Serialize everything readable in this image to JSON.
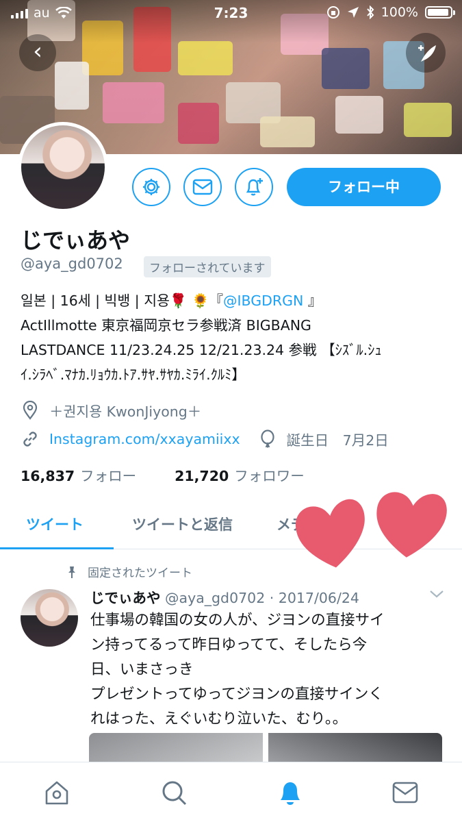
{
  "status_bar": {
    "carrier": "au",
    "time": "7:23",
    "battery": "100%"
  },
  "profile": {
    "name": "じでぃあや",
    "handle": "@aya_gd0702",
    "follows_you": "フォローされています",
    "follow_button": "フォロー中",
    "bio_lines": [
      [
        "일본 | 16세 | 빅뱅 | 지용🌹 🌻『",
        "@IBGDRGN",
        " 』"
      ],
      "ActIllmotte 東京福岡京セラ参戦済 BIGBANG",
      "LASTDANCE 11/23.24.25 12/21.23.24 参戦 【ｼｽﾞﾙ.ｼｭ",
      "ｲ.ｼﾗﾍﾞ.ﾏﾅｶ.ﾘｮｳｶ.ﾄｱ.ｻﾔ.ｻﾔｶ.ﾐﾗｲ.ｸﾙﾐ】"
    ],
    "location": "＋권지용 KwonJiyong＋",
    "website": "Instagram.com/xxayamiixx",
    "birthday": "誕生日　7月2日",
    "following_count": "16,837",
    "following_label": "フォロー",
    "followers_count": "21,720",
    "followers_label": "フォロワー"
  },
  "tabs": [
    {
      "label": "ツイート",
      "active": true
    },
    {
      "label": "ツイートと返信",
      "active": false
    },
    {
      "label": "メディア",
      "active": false
    }
  ],
  "tweet": {
    "pinned_label": "固定されたツイート",
    "author_name": "じでぃあや",
    "author_handle_date": "@aya_gd0702 · 2017/06/24",
    "text_lines": [
      "仕事場の韓国の女の人が、ジヨンの直接サイ",
      "ン持ってるって昨日ゆってて、そしたら今",
      "日、いまさっき",
      "プレゼントってゆってジヨンの直接サインく",
      "れはった、えぐいむり泣いた、むり。。"
    ]
  },
  "icons": {
    "settings": "gear-icon",
    "message": "envelope-icon",
    "notify": "bell-plus-icon",
    "location": "location-pin-icon",
    "link": "link-icon",
    "birthday": "balloon-icon",
    "pin": "pin-icon",
    "home": "home-icon",
    "search": "search-icon",
    "notifications": "bell-icon",
    "messages": "envelope-icon"
  },
  "colors": {
    "accent": "#1da1f2",
    "heart": "#e85a6e"
  }
}
